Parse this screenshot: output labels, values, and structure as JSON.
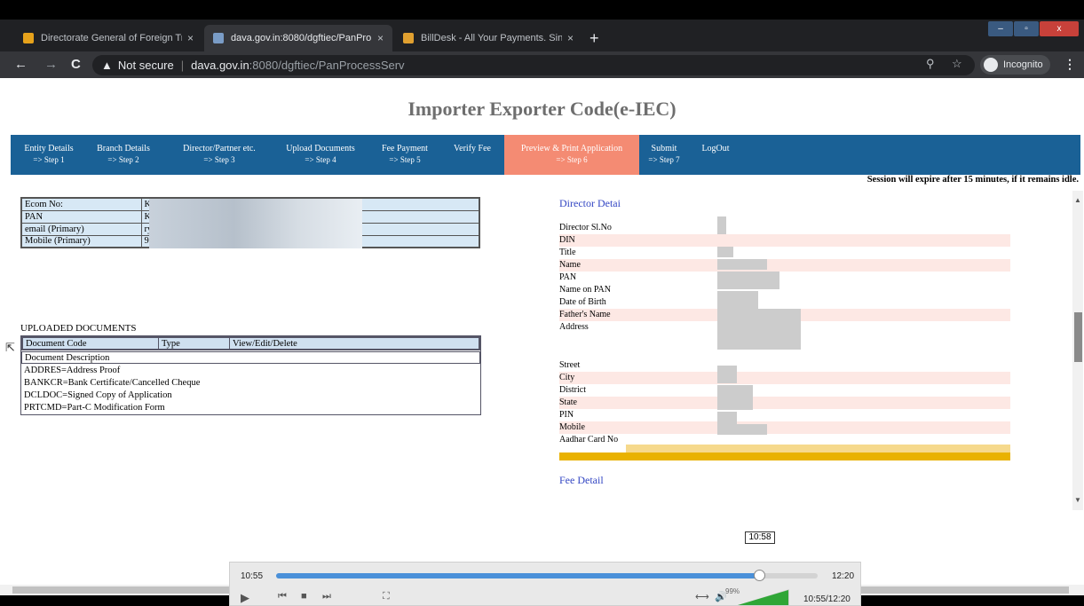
{
  "browser": {
    "tabs": [
      {
        "label": "Directorate General of Foreign Tr",
        "favicon_color": "#e6a21b",
        "active": false
      },
      {
        "label": "dava.gov.in:8080/dgftiec/PanPro",
        "favicon_color": "#7a9cc6",
        "active": true
      },
      {
        "label": "BillDesk - All Your Payments. Sin",
        "favicon_color": "#e0a030",
        "active": false
      }
    ],
    "tab_close": "×",
    "new_tab": "+",
    "window_controls": {
      "minimize": "–",
      "maximize": "▫",
      "close": "x"
    },
    "nav": {
      "back": "←",
      "forward": "→",
      "reload": "C"
    },
    "address": {
      "warning_icon": "▲",
      "security_label": "Not secure",
      "host": "dava.gov.in",
      "path": ":8080/dgftiec/PanProcessServ"
    },
    "zoom_icon": "⚲",
    "star_icon": "☆",
    "incognito_label": "Incognito",
    "menu_icon": "⋮"
  },
  "page": {
    "title": "Importer Exporter Code(e-IEC)",
    "nav": [
      {
        "label": "Entity Details",
        "step": "=> Step 1",
        "active": false
      },
      {
        "label": "Branch Details",
        "step": "=> Step 2",
        "active": false
      },
      {
        "label": "Director/Partner etc.",
        "step": "=> Step 3",
        "active": false
      },
      {
        "label": "Upload Documents",
        "step": "=> Step 4",
        "active": false
      },
      {
        "label": "Fee Payment",
        "step": "=> Step 5",
        "active": false
      },
      {
        "label": "Verify Fee",
        "step": "",
        "active": false
      },
      {
        "label": "Preview & Print Application",
        "step": "=> Step 6",
        "active": true
      },
      {
        "label": "Submit",
        "step": "=> Step 7",
        "active": false
      },
      {
        "label": "LogOut",
        "step": "",
        "active": false
      }
    ],
    "session_note": "Session will expire after   15  minutes, if it remains idle.",
    "info": [
      {
        "label": "Ecom No:",
        "value": "K"
      },
      {
        "label": "PAN",
        "value": "K"
      },
      {
        "label": "email (Primary)",
        "value": "ry"
      },
      {
        "label": "Mobile (Primary)",
        "value": "91"
      }
    ],
    "uploaded_title": "UPLOADED DOCUMENTS",
    "doc_headers": [
      "Document Code",
      "Type",
      "View/Edit/Delete"
    ],
    "doc_desc_header": "Document Description",
    "docs": [
      "ADDRES=Address Proof",
      "BANKCR=Bank Certificate/Cancelled Cheque",
      "DCLDOC=Signed Copy of Application",
      "PRTCMD=Part-C Modification Form"
    ],
    "director_title": "Director Detai",
    "director_fields": [
      {
        "label": "Director Sl.No",
        "pink": false
      },
      {
        "label": "DIN",
        "pink": true
      },
      {
        "label": "Title",
        "pink": false
      },
      {
        "label": "Name",
        "pink": true
      },
      {
        "label": "PAN",
        "pink": false
      },
      {
        "label": "Name on PAN",
        "pink": false
      },
      {
        "label": "Date of Birth",
        "pink": false
      },
      {
        "label": "Father's Name",
        "pink": true
      },
      {
        "label": "Address",
        "pink": false
      }
    ],
    "address_fields": [
      {
        "label": "Street",
        "pink": false
      },
      {
        "label": "City",
        "pink": true
      },
      {
        "label": "District",
        "pink": false
      },
      {
        "label": "State",
        "pink": true
      },
      {
        "label": "PIN",
        "pink": false
      },
      {
        "label": "Mobile",
        "pink": true
      },
      {
        "label": "Aadhar Card No",
        "pink": false
      }
    ],
    "fee_title": "Fee Detail"
  },
  "player": {
    "current_time": "10:55",
    "duration": "12:20",
    "progress": 0.8919,
    "tooltip_time": "10:58",
    "volume_pct": "99%",
    "time_readout": "10:55/12:20",
    "buttons": {
      "play": "▶",
      "prev": "⏮",
      "stop": "■",
      "next": "⏭",
      "fullscreen": "⛶",
      "fit": "⟷",
      "volume": "🔊"
    }
  },
  "colors": {
    "nav_bg": "#1a6196",
    "nav_active": "#f48b73",
    "title_gray": "#6e6e6e",
    "section_blue": "#3346c3"
  }
}
